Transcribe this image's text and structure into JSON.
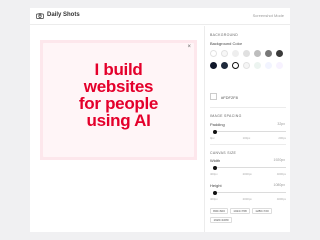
{
  "app": {
    "title": "Daily Shots",
    "mode_link": "Screenshot Mode"
  },
  "preview": {
    "headline_lines": [
      "I build",
      "websites",
      "for people",
      "using AI"
    ],
    "close_glyph": "×",
    "text_color": "#e4002b",
    "background_color": "#fde7ec"
  },
  "panel": {
    "background": {
      "section_title": "BACKGROUND",
      "label": "Background Color",
      "swatches_row1": [
        "#ffffff",
        "#f7f7f7",
        "#eeeeee",
        "#e0e0e0",
        "#bdbdbd",
        "#777777",
        "#3a3a3a"
      ],
      "swatches_row2": [
        "#0f172a",
        "#1e293b",
        "#ffffff",
        "#f5f5f5",
        "#ecf4f0",
        "#f2f4ff",
        "#f7f2ff"
      ],
      "selected_index_row2": 2,
      "hex_value": "#FDF2F8"
    },
    "image_spacing": {
      "section_title": "IMAGE SPACING",
      "padding_label": "Padding",
      "padding_value": "32px",
      "padding_fraction": 0.03,
      "ticks": [
        "0px",
        "100px",
        "200px"
      ]
    },
    "canvas_size": {
      "section_title": "CANVAS SIZE",
      "width_label": "Width",
      "width_value": "1920px",
      "width_fraction": 0.03,
      "width_ticks": [
        "400px",
        "2000px",
        "4000px"
      ],
      "height_label": "Height",
      "height_value": "1080px",
      "height_fraction": 0.03,
      "height_ticks": [
        "400px",
        "2000px",
        "4000px"
      ],
      "presets": [
        "800×600",
        "1024×768",
        "1280×720",
        "1920×1080"
      ]
    }
  }
}
